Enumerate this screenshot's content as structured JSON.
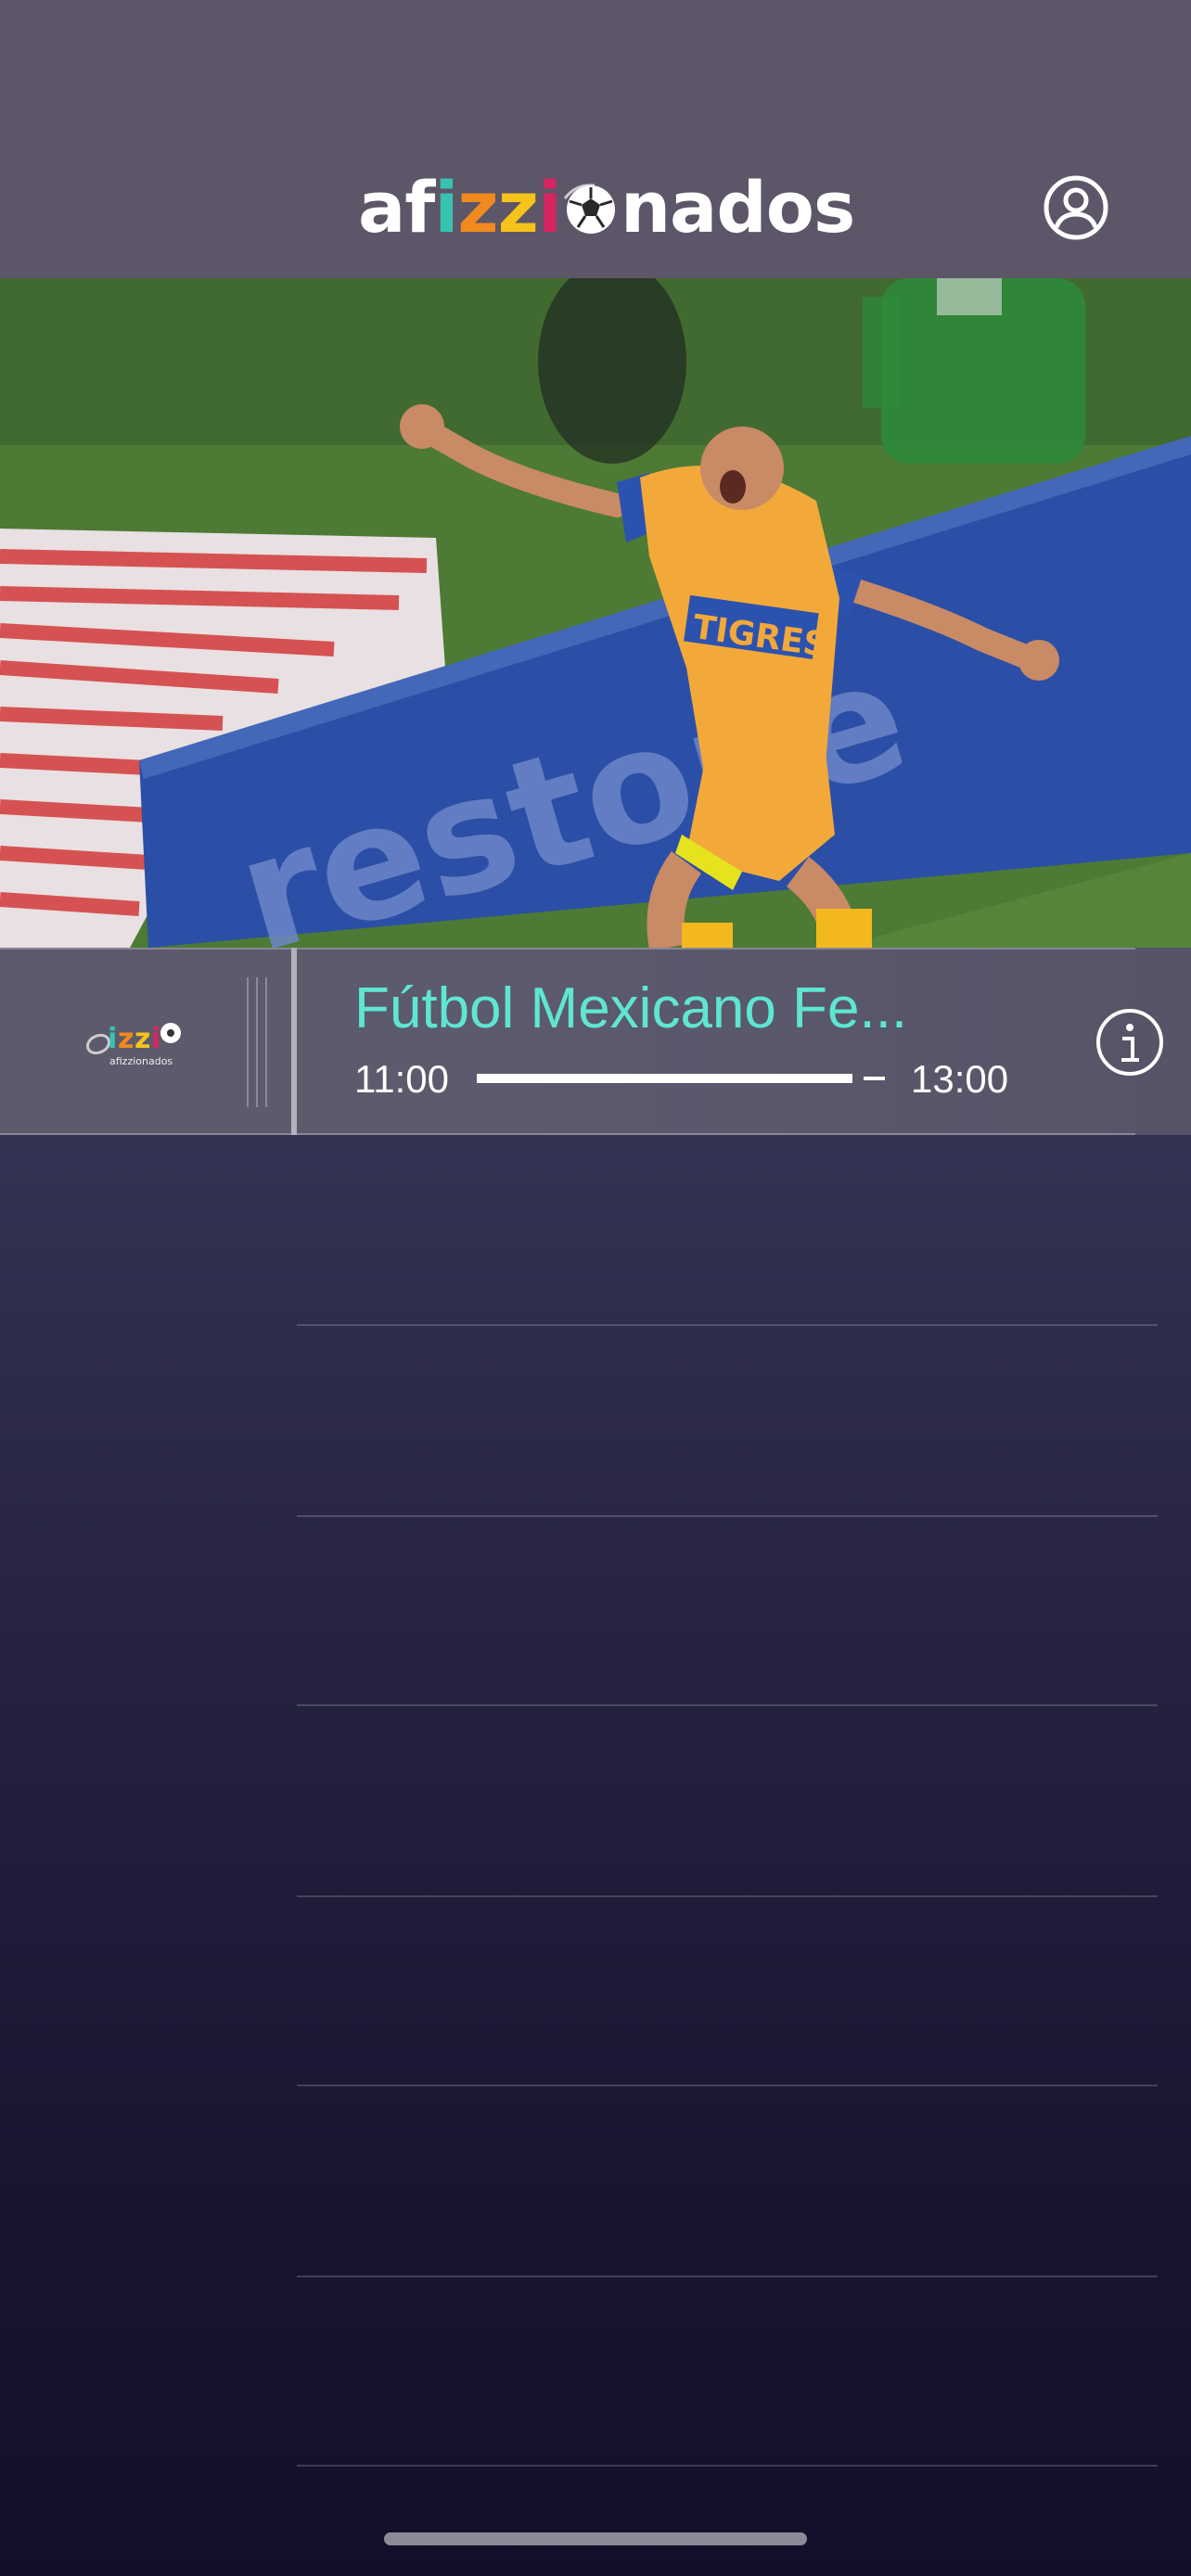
{
  "header": {
    "logo_parts": [
      "af",
      "i",
      "z",
      "z",
      "i",
      "nados"
    ],
    "logo_colors": {
      "white": "#ffffff",
      "teal": "#38c2b0",
      "orange": "#f08a1e",
      "yellow": "#f6c31b",
      "magenta": "#d8245f"
    },
    "profile_icon": "user-circle-icon"
  },
  "video": {
    "content": "soccer-player-celebration",
    "jersey_text": "TIGRES"
  },
  "program": {
    "channel_logo_text": "afizzionados",
    "title": "Fútbol Mexicano Fe...",
    "start_time": "11:00",
    "end_time": "13:00",
    "progress": 0.92,
    "info_icon": "info-circle-icon"
  },
  "colors": {
    "accent": "#5fe6d2",
    "header_bg": "#5c5668"
  }
}
